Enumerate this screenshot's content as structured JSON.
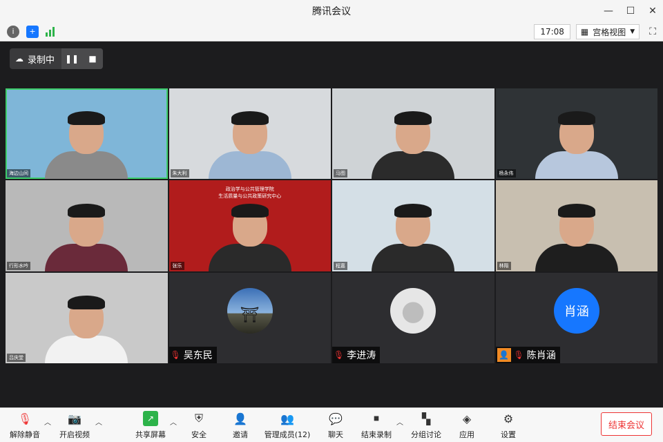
{
  "window": {
    "title": "腾讯会议"
  },
  "topbar": {
    "clock": "17:08",
    "view_label": "宫格视图"
  },
  "recording": {
    "label": "录制中"
  },
  "tiles": [
    {
      "name": "海边山间",
      "bg": "#7fb6d8",
      "shirt": "#8a8a8a"
    },
    {
      "name": "朱大利",
      "bg": "#d7dadd",
      "shirt": "#9db7d4"
    },
    {
      "name": "马图",
      "bg": "#cfd3d6",
      "shirt": "#2b2b2b"
    },
    {
      "name": "杨永伟",
      "bg": "#2f3336",
      "shirt": "#b7c7dd"
    },
    {
      "name": "行形水吟",
      "bg": "#b9b9b9",
      "shirt": "#6a2a3a"
    },
    {
      "name": "张乐",
      "bg": "#b11c1c",
      "shirt": "#2a2a2a",
      "banner_title": "政治学与公共管理学院",
      "banner_sub": "生活质量与公共政策研究中心"
    },
    {
      "name": "程嘉",
      "bg": "#d4dfe6",
      "shirt": "#2a2a2a"
    },
    {
      "name": "林翔",
      "bg": "#c8bfb0",
      "shirt": "#1e1e1e"
    },
    {
      "name": "吕庆堂",
      "bg": "#c9c9c9",
      "shirt": "#f2f2f2"
    },
    {
      "name": "吴东民",
      "avatar": "landscape"
    },
    {
      "name": "李进涛",
      "avatar": "default"
    },
    {
      "name": "陈肖涵",
      "avatar": "text",
      "avatar_text": "肖涵"
    }
  ],
  "toolbar": {
    "unmute": "解除静音",
    "video": "开启视频",
    "share": "共享屏幕",
    "security": "安全",
    "invite": "邀请",
    "members": "管理成员(12)",
    "chat": "聊天",
    "record": "结束录制",
    "breakout": "分组讨论",
    "apps": "应用",
    "settings": "设置",
    "end": "结束会议"
  },
  "colors": {
    "accent_green": "#3dce6b",
    "end_red": "#e33333",
    "avatar_blue": "#1677ff"
  }
}
